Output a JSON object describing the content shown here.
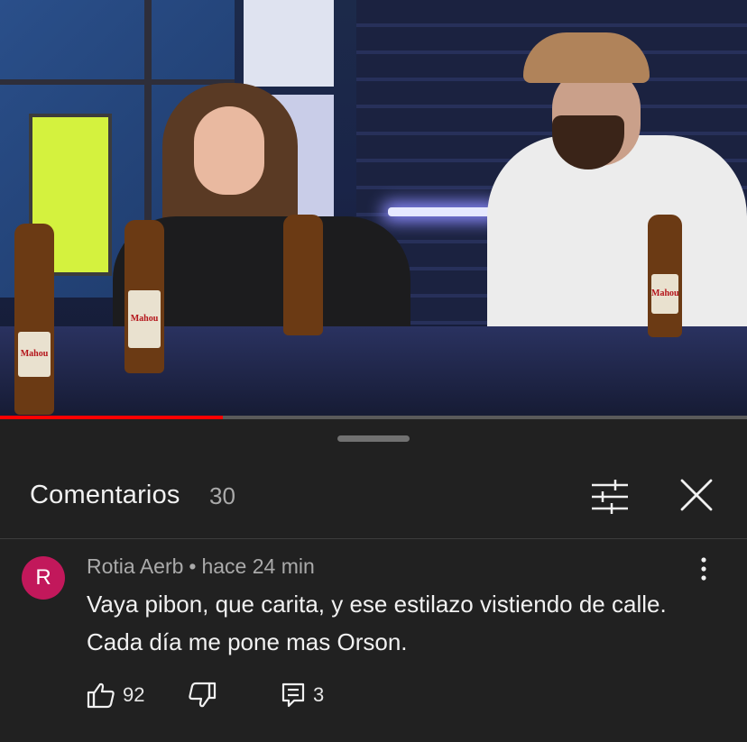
{
  "video": {
    "bottle_labels": [
      "Mahou",
      "Mahou",
      "Mahou"
    ],
    "progress_fraction": 0.298
  },
  "sheet": {
    "title": "Comentarios",
    "count": "30"
  },
  "icons": {
    "filter": "tune-icon",
    "close": "close-icon",
    "more": "more-vert-icon",
    "like": "thumb-up-icon",
    "dislike": "thumb-down-icon",
    "reply": "reply-icon"
  },
  "comment": {
    "avatar_letter": "R",
    "avatar_color": "#c2185b",
    "author": "Rotia Aerb",
    "separator": "•",
    "time": "hace 24 min",
    "lines": [
      "Vaya pibon, que carita, y ese estilazo vistiendo de calle.",
      "Cada día me pone mas Orson."
    ],
    "likes": "92",
    "replies": "3"
  },
  "colors": {
    "progress": "#ff0000",
    "background": "#212121"
  }
}
